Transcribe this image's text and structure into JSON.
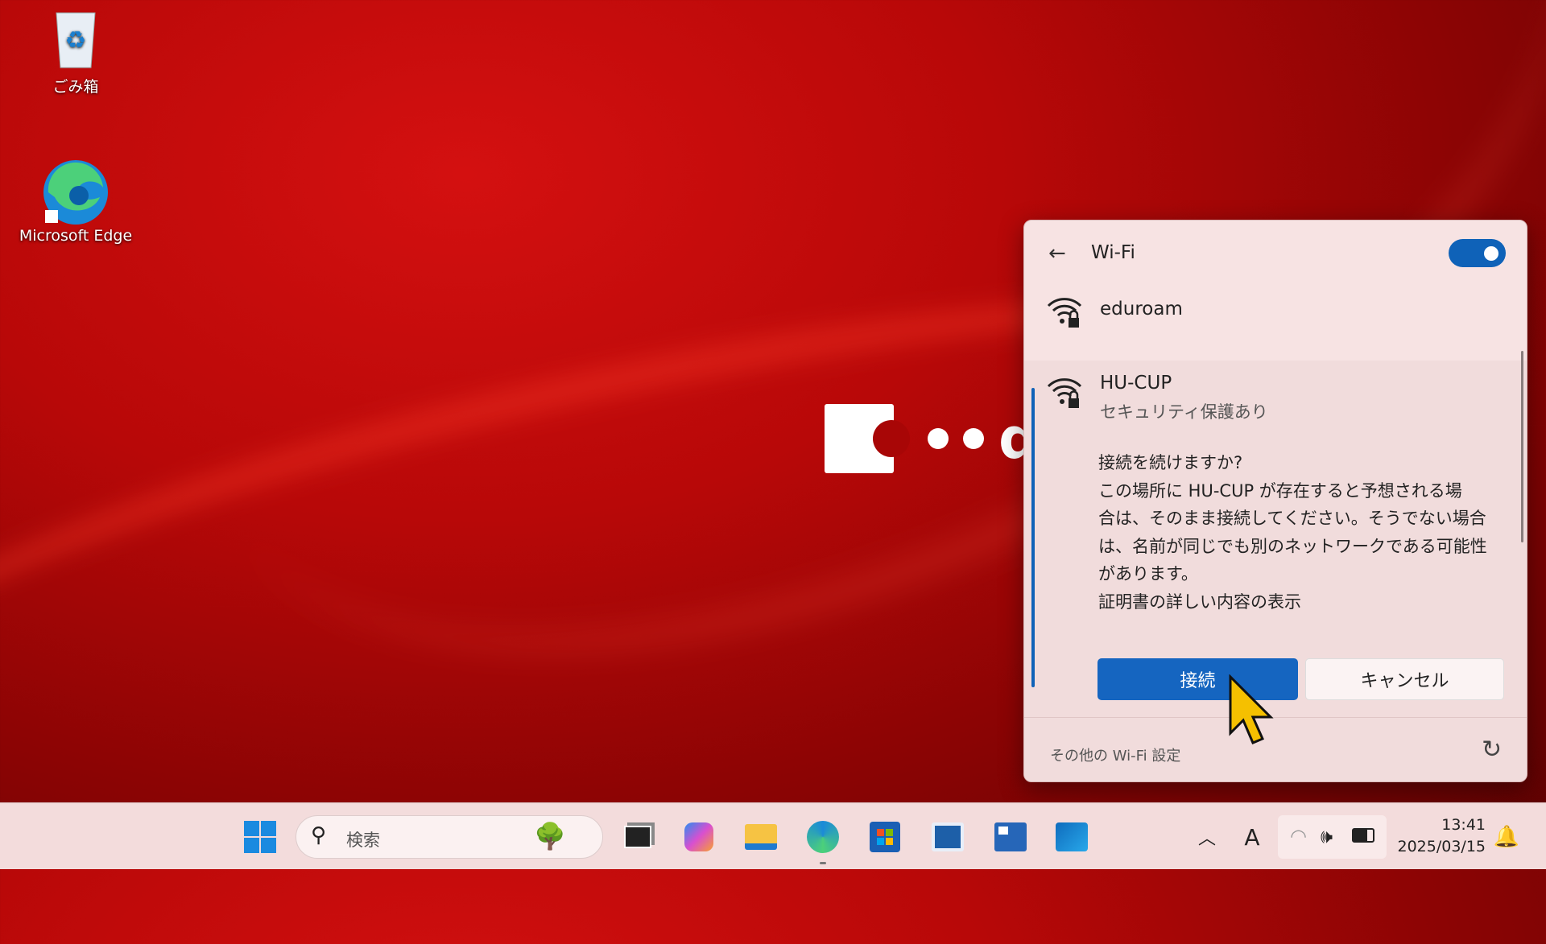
{
  "desktop": {
    "icons": [
      {
        "label": "ごみ箱",
        "icon": "recycle-bin-icon"
      },
      {
        "label": "Microsoft Edge",
        "icon": "edge-icon"
      }
    ],
    "logo_text": "dy"
  },
  "wifi_panel": {
    "title": "Wi-Fi",
    "toggle_on": true,
    "networks": [
      {
        "name": "eduroam",
        "icon": "wifi-lock-icon"
      },
      {
        "name": "HU-CUP",
        "status": "セキュリティ保護あり",
        "icon": "wifi-lock-icon"
      }
    ],
    "prompt": {
      "lines": [
        "接続を続けますか?",
        "この場所に HU-CUP が存在すると予想される場",
        "合は、そのまま接続してください。そうでない場合",
        "は、名前が同じでも別のネットワークである可能性",
        "があります。"
      ],
      "cert_link": "証明書の詳しい内容の表示"
    },
    "connect_label": "接続",
    "cancel_label": "キャンセル",
    "more_settings": "その他の Wi-Fi 設定"
  },
  "taskbar": {
    "search_placeholder": "検索",
    "time": "13:41",
    "date": "2025/03/15"
  },
  "colors": {
    "accent": "#0f62b8",
    "panel": "#f7e3e3"
  }
}
